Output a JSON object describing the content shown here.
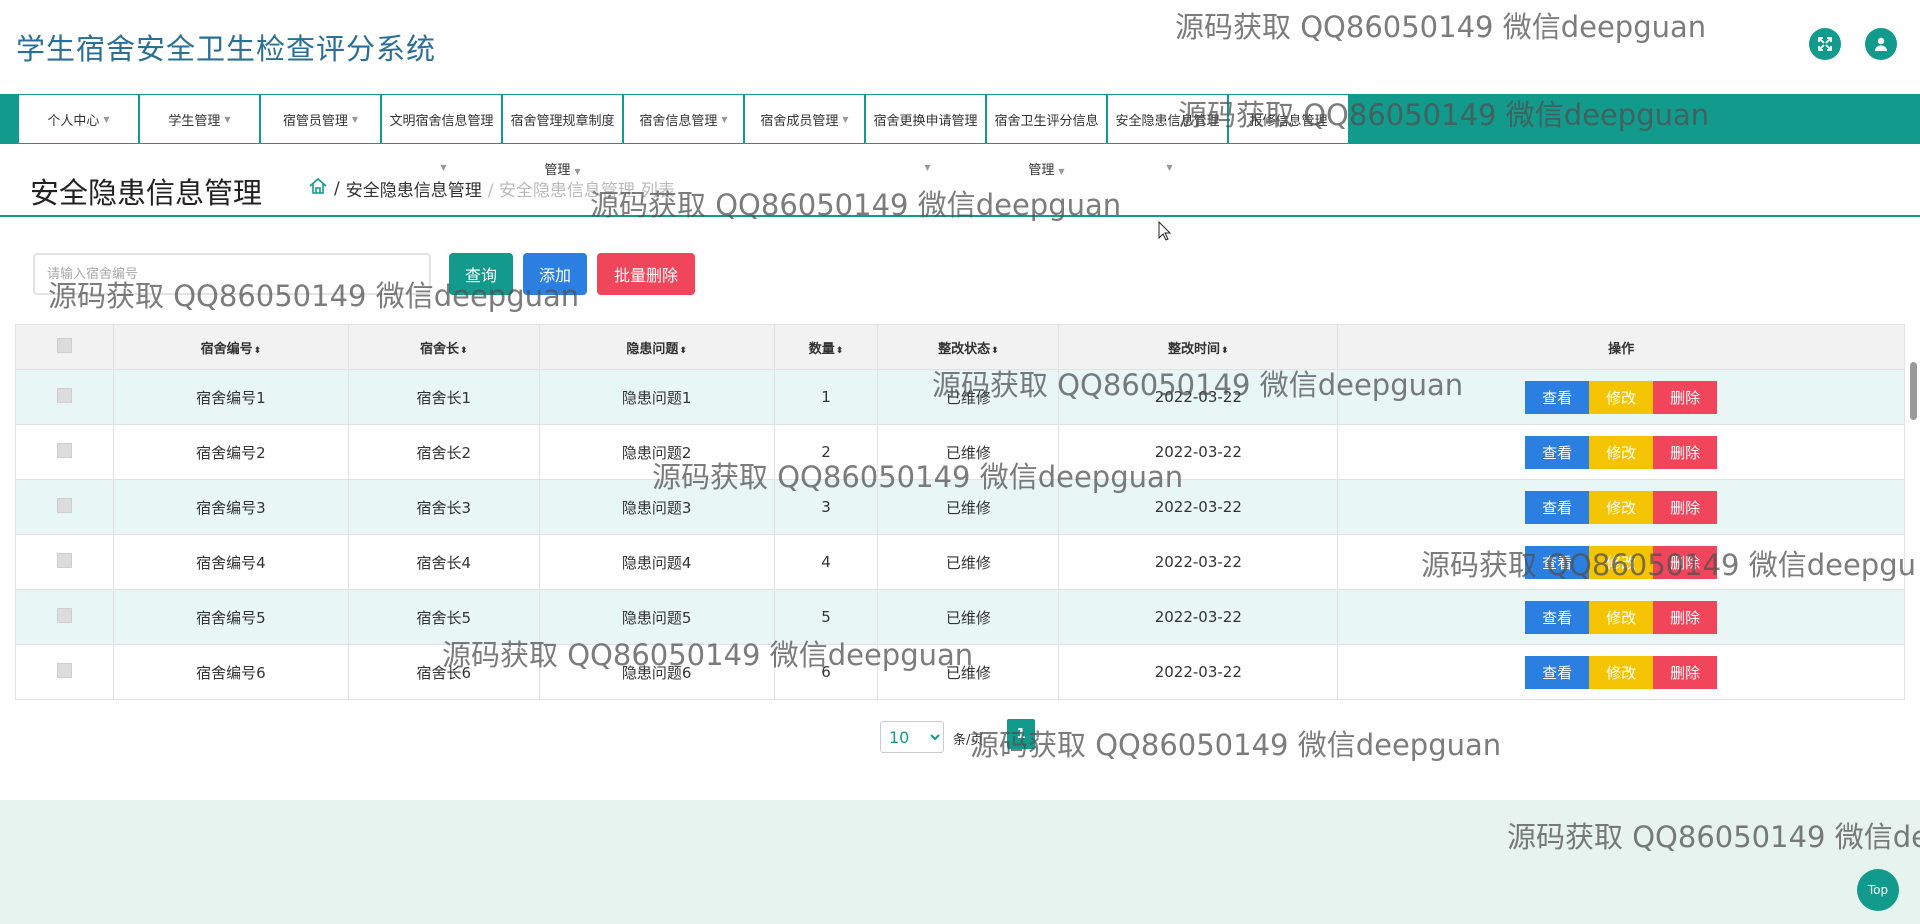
{
  "app": {
    "title": "学生宿舍安全卫生检查评分系统",
    "fullscreen_icon": "expand-icon",
    "user_icon": "user-icon"
  },
  "nav": {
    "items": [
      {
        "label": "个人中心",
        "sub": ""
      },
      {
        "label": "学生管理",
        "sub": ""
      },
      {
        "label": "宿管员管理",
        "sub": ""
      },
      {
        "label": "文明宿舍信息管理",
        "sub": ""
      },
      {
        "label": "宿舍管理规章制度",
        "sub": "管理"
      },
      {
        "label": "宿舍信息管理",
        "sub": ""
      },
      {
        "label": "宿舍成员管理",
        "sub": ""
      },
      {
        "label": "宿舍更换申请管理",
        "sub": ""
      },
      {
        "label": "宿舍卫生评分信息",
        "sub": "管理"
      },
      {
        "label": "安全隐患信息管理",
        "sub": ""
      },
      {
        "label": "报修信息管理",
        "sub": ""
      }
    ]
  },
  "page": {
    "title": "安全隐患信息管理",
    "breadcrumb_sep": "/",
    "breadcrumb_current": "安全隐患信息管理",
    "breadcrumb_faded": "/ 安全隐患信息管理",
    "breadcrumb_tail": "列表"
  },
  "toolbar": {
    "search_placeholder": "请输入宿舍编号",
    "query_label": "查询",
    "add_label": "添加",
    "batch_delete_label": "批量删除"
  },
  "table": {
    "columns": [
      "宿舍编号",
      "宿舍长",
      "隐患问题",
      "数量",
      "整改状态",
      "整改时间",
      "操作"
    ],
    "sort_glyph": "⬍",
    "actions": {
      "view": "查看",
      "edit": "修改",
      "delete": "删除"
    },
    "rows": [
      {
        "dorm_no": "宿舍编号1",
        "head": "宿舍长1",
        "issue": "隐患问题1",
        "qty": "1",
        "status": "已维修",
        "time": "2022-03-22"
      },
      {
        "dorm_no": "宿舍编号2",
        "head": "宿舍长2",
        "issue": "隐患问题2",
        "qty": "2",
        "status": "已维修",
        "time": "2022-03-22"
      },
      {
        "dorm_no": "宿舍编号3",
        "head": "宿舍长3",
        "issue": "隐患问题3",
        "qty": "3",
        "status": "已维修",
        "time": "2022-03-22"
      },
      {
        "dorm_no": "宿舍编号4",
        "head": "宿舍长4",
        "issue": "隐患问题4",
        "qty": "4",
        "status": "已维修",
        "time": "2022-03-22"
      },
      {
        "dorm_no": "宿舍编号5",
        "head": "宿舍长5",
        "issue": "隐患问题5",
        "qty": "5",
        "status": "已维修",
        "time": "2022-03-22"
      },
      {
        "dorm_no": "宿舍编号6",
        "head": "宿舍长6",
        "issue": "隐患问题6",
        "qty": "6",
        "status": "已维修",
        "time": "2022-03-22"
      }
    ]
  },
  "pagination": {
    "page_size": "10",
    "page_size_suffix": "条/页",
    "current_page": "1"
  },
  "footer": {
    "top_label": "Top"
  },
  "watermark": {
    "text": "源码获取 QQ86050149 微信deepguan",
    "text_clipped": "源码获取 QQ86050149 微信deepgu",
    "text_clipped2": "源码获取 QQ86050149 微信de"
  },
  "colors": {
    "primary": "#129a8c",
    "blue": "#2b7fe0",
    "yellow": "#f5c400",
    "red": "#f0455a"
  }
}
